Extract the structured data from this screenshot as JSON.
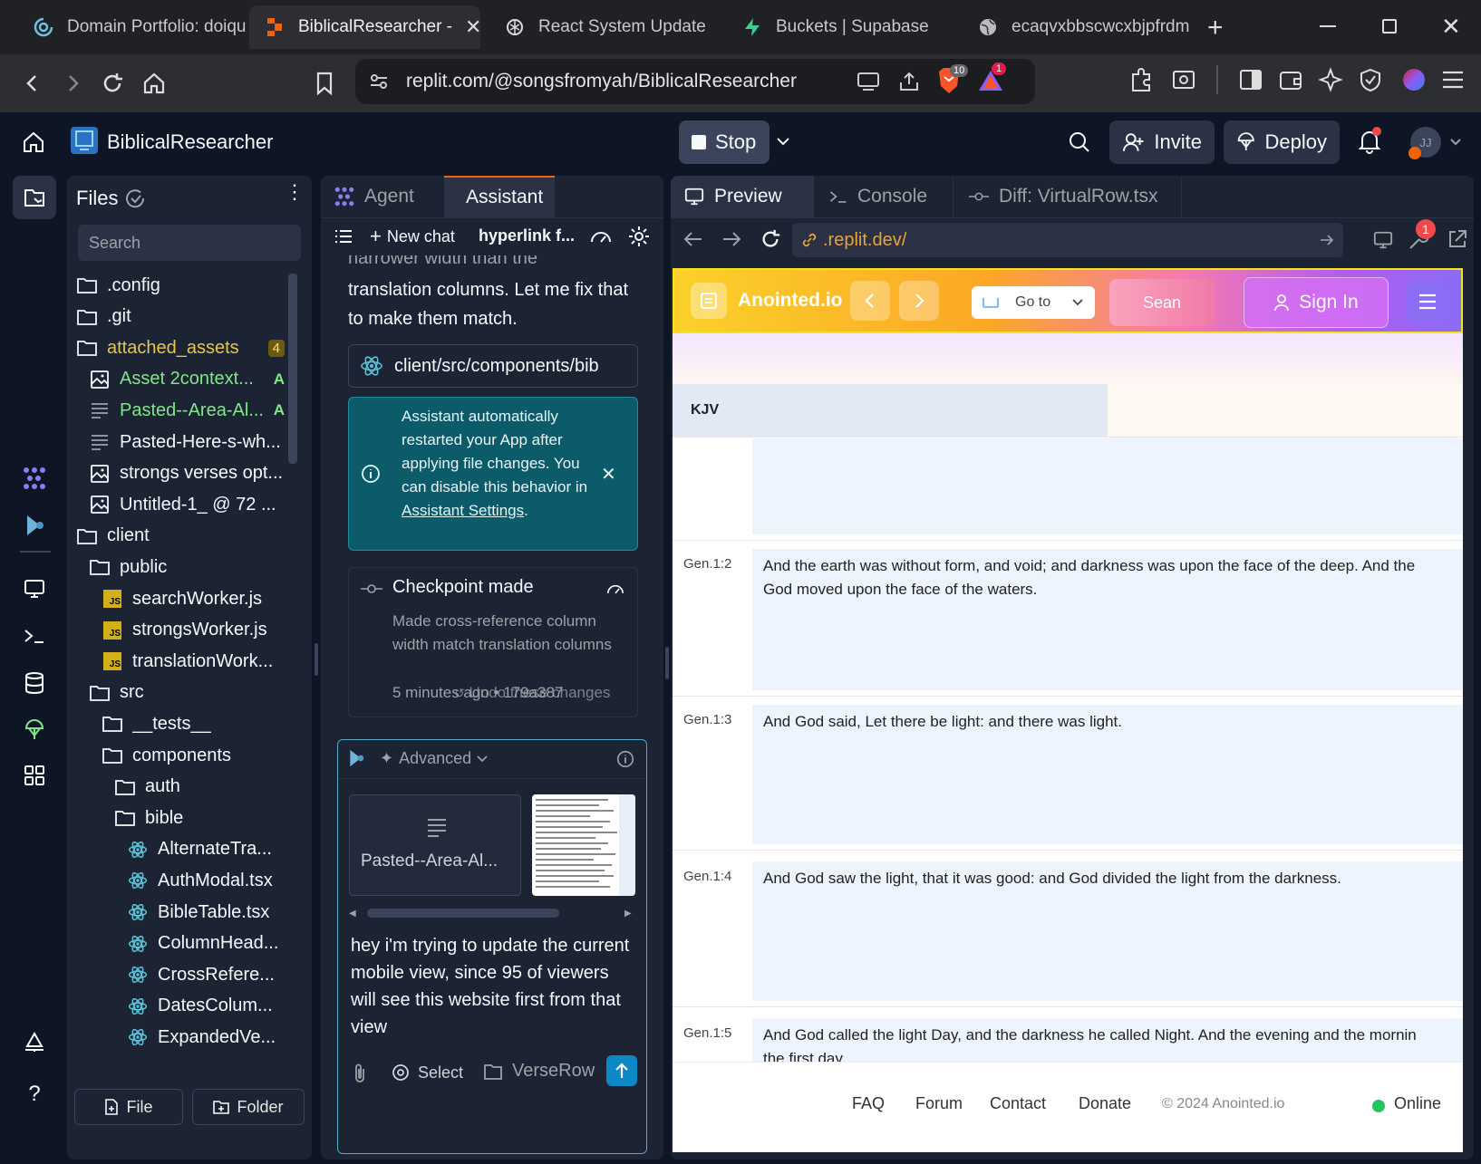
{
  "browser": {
    "tabs": [
      {
        "label": "Domain Portfolio: doiqu",
        "icon": "domain-icon"
      },
      {
        "label": "BiblicalResearcher -",
        "icon": "replit-icon",
        "active": true
      },
      {
        "label": "React System Update",
        "icon": "openai-icon"
      },
      {
        "label": "Buckets | Supabase",
        "icon": "supabase-icon"
      },
      {
        "label": "ecaqvxbbscwcxbjpfrdm",
        "icon": "globe-icon"
      }
    ],
    "url": "replit.com/@songsfromyah/BiblicalResearcher",
    "brave_badge": "10",
    "alert_badge": "1"
  },
  "replit": {
    "project_name": "BiblicalResearcher",
    "stop_label": "Stop",
    "invite_label": "Invite",
    "deploy_label": "Deploy",
    "avatar_initials": "JJ"
  },
  "files": {
    "title": "Files",
    "search_placeholder": "Search",
    "items": [
      {
        "name": ".config",
        "type": "folder",
        "indent": 0
      },
      {
        "name": ".git",
        "type": "folder",
        "indent": 0
      },
      {
        "name": "attached_assets",
        "type": "folder",
        "indent": 0,
        "badge": "4",
        "color": "#e3c94a"
      },
      {
        "name": "Asset 2context...",
        "type": "image",
        "indent": 1,
        "status": "A",
        "color": "#7ee787"
      },
      {
        "name": "Pasted--Area-Al...",
        "type": "text",
        "indent": 1,
        "status": "A",
        "color": "#7ee787"
      },
      {
        "name": "Pasted-Here-s-wh...",
        "type": "text",
        "indent": 1
      },
      {
        "name": "strongs verses opt...",
        "type": "image",
        "indent": 1
      },
      {
        "name": "Untitled-1_ @ 72 ...",
        "type": "image",
        "indent": 1
      },
      {
        "name": "client",
        "type": "folder",
        "indent": 0
      },
      {
        "name": "public",
        "type": "folder",
        "indent": 1
      },
      {
        "name": "searchWorker.js",
        "type": "js",
        "indent": 2
      },
      {
        "name": "strongsWorker.js",
        "type": "js",
        "indent": 2
      },
      {
        "name": "translationWork...",
        "type": "js",
        "indent": 2
      },
      {
        "name": "src",
        "type": "folder",
        "indent": 1
      },
      {
        "name": "__tests__",
        "type": "folder",
        "indent": 2
      },
      {
        "name": "components",
        "type": "folder",
        "indent": 2
      },
      {
        "name": "auth",
        "type": "folder",
        "indent": 3
      },
      {
        "name": "bible",
        "type": "folder",
        "indent": 3
      },
      {
        "name": "AlternateTra...",
        "type": "react",
        "indent": 4
      },
      {
        "name": "AuthModal.tsx",
        "type": "react",
        "indent": 4
      },
      {
        "name": "BibleTable.tsx",
        "type": "react",
        "indent": 4
      },
      {
        "name": "ColumnHead...",
        "type": "react",
        "indent": 4
      },
      {
        "name": "CrossRefere...",
        "type": "react",
        "indent": 4
      },
      {
        "name": "DatesColum...",
        "type": "react",
        "indent": 4
      },
      {
        "name": "ExpandedVe...",
        "type": "react",
        "indent": 4
      }
    ],
    "file_button": "File",
    "folder_button": "Folder"
  },
  "assistant": {
    "tabs": [
      "Agent",
      "Assistant"
    ],
    "new_chat": "New chat",
    "chat_title": "hyperlink f...",
    "message_partial_top": "narrower width than the",
    "message_text": "translation columns. Let me fix that to make them match.",
    "file_path": "client/src/components/bib",
    "notice_text": "Assistant automatically restarted your App after applying file changes. You can disable this behavior in",
    "notice_link": "Assistant Settings",
    "notice_period": ".",
    "checkpoint_title": "Checkpoint made",
    "checkpoint_desc": "Made cross-reference column width match translation columns",
    "checkpoint_footer": "5 minutes ago • 179a387",
    "checkpoint_footer_overlay": "Undo these changes",
    "mode_label": "Advanced",
    "attachment_name": "Pasted--Area-Al...",
    "input_text": "hey i'm trying to update the current mobile view, since 95 of viewers will see this website first from that view",
    "select_label": "Select",
    "file_context_label": "VerseRow"
  },
  "preview": {
    "tabs": [
      "Preview",
      "Console",
      "Diff: VirtualRow.tsx"
    ],
    "url": ".replit.dev/",
    "wrench_badge": "1",
    "site": {
      "brand": "Anointed.io",
      "goto_label": "Go to",
      "search_label": "Sean",
      "signin_label": "Sign In",
      "column_header": "KJV",
      "verses": [
        {
          "ref": "Gen.1:2",
          "text_lines": [
            "And the earth was without form, and void; and darkness was upon the face of the deep. And the",
            "God moved upon the face of the waters."
          ]
        },
        {
          "ref": "Gen.1:3",
          "text_lines": [
            "And God said, Let there be light: and there was light."
          ]
        },
        {
          "ref": "Gen.1:4",
          "text_lines": [
            "And God saw the light, that it was good: and God divided the light from the darkness."
          ]
        },
        {
          "ref": "Gen.1:5",
          "text_lines": [
            "And God called the light Day, and the darkness he called Night. And the evening and the mornin",
            "the first day."
          ]
        }
      ],
      "footer_links": [
        "FAQ",
        "Forum",
        "Contact",
        "Donate"
      ],
      "copyright": "© 2024 Anointed.io",
      "status": "Online"
    }
  },
  "colors": {
    "replit_bg": "#0e1525",
    "panel_bg": "#1c2333",
    "accent_orange": "#f26207",
    "notice_teal": "#0b5b6b",
    "online_green": "#22c55e"
  }
}
